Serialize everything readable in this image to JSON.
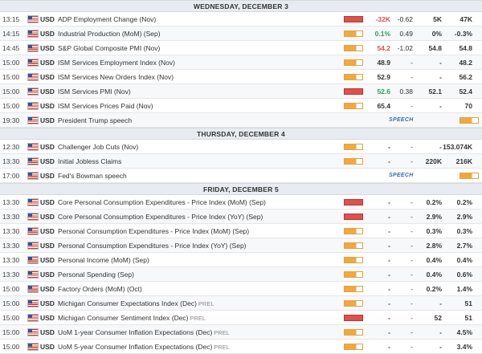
{
  "days": [
    {
      "header": "WEDNESDAY, DECEMBER 3",
      "events": [
        {
          "time": "13:15",
          "currency": "USD",
          "name": "ADP Employment Change (Nov)",
          "tag": "",
          "impact": "high",
          "actual": "-32K",
          "actual_tone": "neg",
          "deviation": "-0.62",
          "consensus": "5K",
          "previous": "47K",
          "speech": ""
        },
        {
          "time": "14:15",
          "currency": "USD",
          "name": "Industrial Production (MoM) (Sep)",
          "tag": "",
          "impact": "med",
          "actual": "0.1%",
          "actual_tone": "pos",
          "deviation": "0.49",
          "consensus": "0%",
          "previous": "-0.3%",
          "speech": ""
        },
        {
          "time": "14:45",
          "currency": "USD",
          "name": "S&P Global Composite PMI (Nov)",
          "tag": "",
          "impact": "med",
          "actual": "54.2",
          "actual_tone": "neg",
          "deviation": "-1.02",
          "consensus": "54.8",
          "previous": "54.8",
          "speech": ""
        },
        {
          "time": "15:00",
          "currency": "USD",
          "name": "ISM Services Employment Index (Nov)",
          "tag": "",
          "impact": "med",
          "actual": "48.9",
          "actual_tone": "",
          "deviation": "-",
          "consensus": "-",
          "previous": "48.2",
          "speech": ""
        },
        {
          "time": "15:00",
          "currency": "USD",
          "name": "ISM Services New Orders Index (Nov)",
          "tag": "",
          "impact": "med",
          "actual": "52.9",
          "actual_tone": "",
          "deviation": "-",
          "consensus": "-",
          "previous": "56.2",
          "speech": ""
        },
        {
          "time": "15:00",
          "currency": "USD",
          "name": "ISM Services PMI (Nov)",
          "tag": "",
          "impact": "high",
          "actual": "52.6",
          "actual_tone": "pos",
          "deviation": "0.38",
          "consensus": "52.1",
          "previous": "52.4",
          "speech": ""
        },
        {
          "time": "15:00",
          "currency": "USD",
          "name": "ISM Services Prices Paid (Nov)",
          "tag": "",
          "impact": "med",
          "actual": "65.4",
          "actual_tone": "",
          "deviation": "-",
          "consensus": "-",
          "previous": "70",
          "speech": ""
        },
        {
          "time": "19:30",
          "currency": "USD",
          "name": "President Trump speech",
          "tag": "",
          "impact": "med",
          "actual": "",
          "actual_tone": "",
          "deviation": "",
          "consensus": "",
          "previous": "",
          "speech": "SPEECH"
        }
      ]
    },
    {
      "header": "THURSDAY, DECEMBER 4",
      "events": [
        {
          "time": "12:30",
          "currency": "USD",
          "name": "Challenger Job Cuts (Nov)",
          "tag": "",
          "impact": "med",
          "actual": "-",
          "actual_tone": "",
          "deviation": "-",
          "consensus": "-",
          "previous": "153.074K",
          "speech": ""
        },
        {
          "time": "13:30",
          "currency": "USD",
          "name": "Initial Jobless Claims",
          "tag": "",
          "impact": "med",
          "actual": "-",
          "actual_tone": "",
          "deviation": "-",
          "consensus": "220K",
          "previous": "216K",
          "speech": ""
        },
        {
          "time": "17:00",
          "currency": "USD",
          "name": "Fed's Bowman speech",
          "tag": "",
          "impact": "med",
          "actual": "",
          "actual_tone": "",
          "deviation": "",
          "consensus": "",
          "previous": "",
          "speech": "SPEECH"
        }
      ]
    },
    {
      "header": "FRIDAY, DECEMBER 5",
      "events": [
        {
          "time": "13:30",
          "currency": "USD",
          "name": "Core Personal Consumption Expenditures - Price Index (MoM) (Sep)",
          "tag": "",
          "impact": "high",
          "actual": "-",
          "actual_tone": "",
          "deviation": "-",
          "consensus": "0.2%",
          "previous": "0.2%",
          "speech": ""
        },
        {
          "time": "13:30",
          "currency": "USD",
          "name": "Core Personal Consumption Expenditures - Price Index (YoY) (Sep)",
          "tag": "",
          "impact": "high",
          "actual": "-",
          "actual_tone": "",
          "deviation": "-",
          "consensus": "2.9%",
          "previous": "2.9%",
          "speech": ""
        },
        {
          "time": "13:30",
          "currency": "USD",
          "name": "Personal Consumption Expenditures - Price Index (MoM) (Sep)",
          "tag": "",
          "impact": "med",
          "actual": "-",
          "actual_tone": "",
          "deviation": "-",
          "consensus": "0.3%",
          "previous": "0.3%",
          "speech": ""
        },
        {
          "time": "13:30",
          "currency": "USD",
          "name": "Personal Consumption Expenditures - Price Index (YoY) (Sep)",
          "tag": "",
          "impact": "med",
          "actual": "-",
          "actual_tone": "",
          "deviation": "-",
          "consensus": "2.8%",
          "previous": "2.7%",
          "speech": ""
        },
        {
          "time": "13:30",
          "currency": "USD",
          "name": "Personal Income (MoM) (Sep)",
          "tag": "",
          "impact": "med",
          "actual": "-",
          "actual_tone": "",
          "deviation": "-",
          "consensus": "0.4%",
          "previous": "0.4%",
          "speech": ""
        },
        {
          "time": "13:30",
          "currency": "USD",
          "name": "Personal Spending (Sep)",
          "tag": "",
          "impact": "med",
          "actual": "-",
          "actual_tone": "",
          "deviation": "-",
          "consensus": "0.4%",
          "previous": "0.6%",
          "speech": ""
        },
        {
          "time": "15:00",
          "currency": "USD",
          "name": "Factory Orders (MoM) (Oct)",
          "tag": "",
          "impact": "med",
          "actual": "-",
          "actual_tone": "",
          "deviation": "-",
          "consensus": "0.2%",
          "previous": "1.4%",
          "speech": ""
        },
        {
          "time": "15:00",
          "currency": "USD",
          "name": "Michigan Consumer Expectations Index (Dec)",
          "tag": "PREL",
          "impact": "med",
          "actual": "-",
          "actual_tone": "",
          "deviation": "-",
          "consensus": "-",
          "previous": "51",
          "speech": ""
        },
        {
          "time": "15:00",
          "currency": "USD",
          "name": "Michigan Consumer Sentiment Index (Dec)",
          "tag": "PREL",
          "impact": "high",
          "actual": "-",
          "actual_tone": "",
          "deviation": "-",
          "consensus": "52",
          "previous": "51",
          "speech": ""
        },
        {
          "time": "15:00",
          "currency": "USD",
          "name": "UoM 1-year Consumer Inflation Expectations (Dec)",
          "tag": "PREL",
          "impact": "med",
          "actual": "-",
          "actual_tone": "",
          "deviation": "-",
          "consensus": "-",
          "previous": "4.5%",
          "speech": ""
        },
        {
          "time": "15:00",
          "currency": "USD",
          "name": "UoM 5-year Consumer Inflation Expectations (Dec)",
          "tag": "PREL",
          "impact": "med",
          "actual": "-",
          "actual_tone": "",
          "deviation": "-",
          "consensus": "-",
          "previous": "3.4%",
          "speech": ""
        }
      ]
    }
  ],
  "colors": {
    "high": "#d9534f",
    "medium": "#f0a844",
    "negative": "#d9534f",
    "positive": "#2e9e5b",
    "speech": "#3b6ea8"
  }
}
